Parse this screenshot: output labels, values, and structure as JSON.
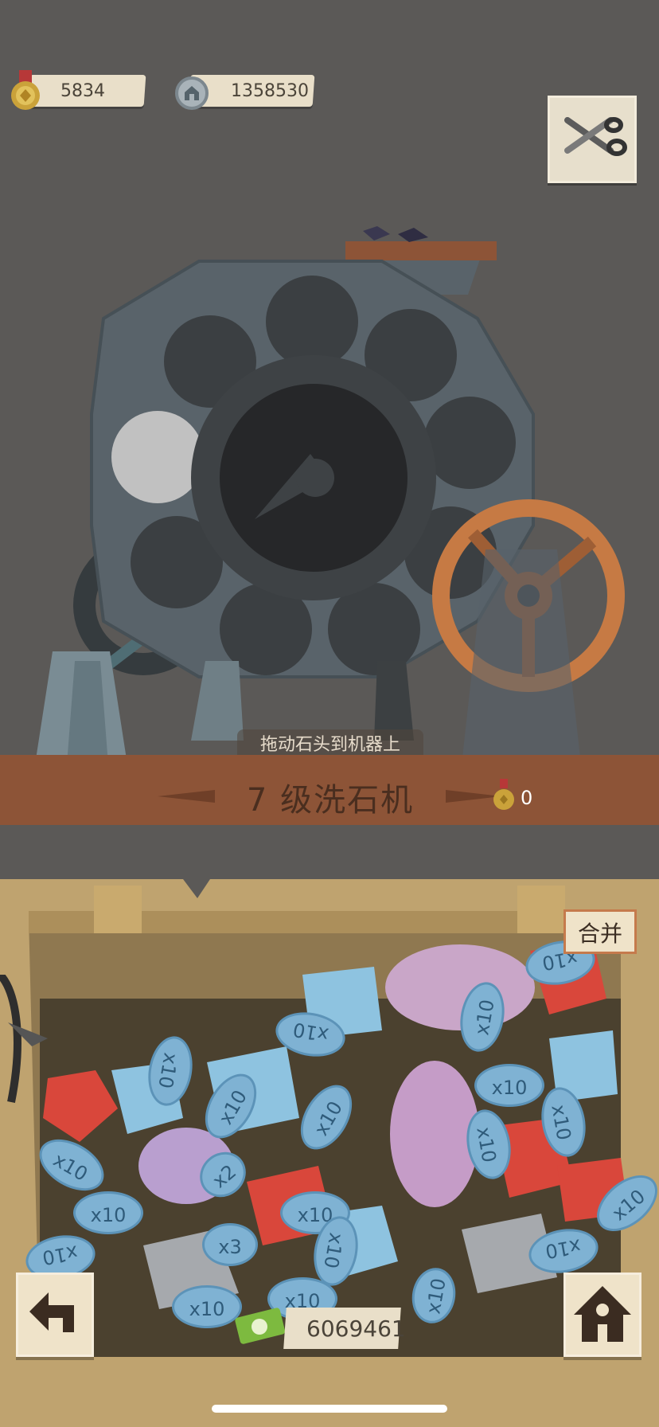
{
  "hud": {
    "medals": "5834",
    "coins": "1358530"
  },
  "machine": {
    "instruction": "拖动石头到机器上",
    "title": "7 级洗石机",
    "reward": "0"
  },
  "crate": {
    "merge_label": "合并",
    "money": "6069461",
    "gem_tags": [
      "x10",
      "x10",
      "x10",
      "x10",
      "x10",
      "x10",
      "x10",
      "x10",
      "x2",
      "x10",
      "x10",
      "x10",
      "x10",
      "x10",
      "x10",
      "x10",
      "x10",
      "x3",
      "x10",
      "x10",
      "x10",
      "x10"
    ]
  },
  "colors": {
    "background": "#5b5957",
    "machine_stone": "#59636a",
    "wood": "#8d5437",
    "crate": "#bfa36f",
    "ruby": "#d9473b",
    "diamond": "#8ec3e0"
  }
}
